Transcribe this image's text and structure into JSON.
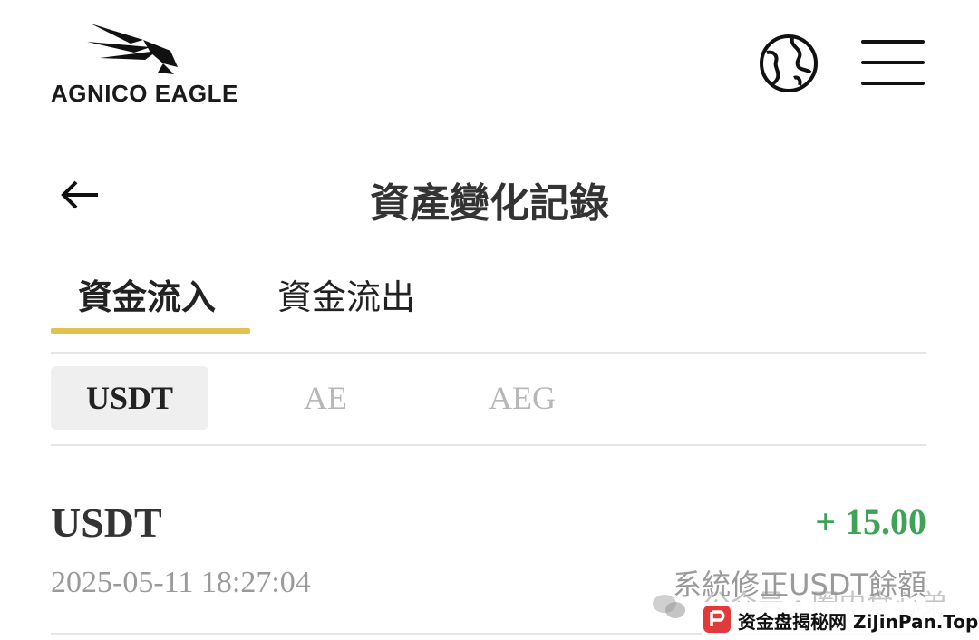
{
  "header": {
    "logo_text": "AGNICO EAGLE",
    "globe_icon": "globe-icon",
    "menu_icon": "hamburger-menu-icon"
  },
  "title_bar": {
    "back_icon": "arrow-left-icon",
    "title": "資產變化記錄"
  },
  "tabs": [
    {
      "label": "資金流入",
      "active": true
    },
    {
      "label": "資金流出",
      "active": false
    }
  ],
  "currency_filter": [
    {
      "label": "USDT",
      "active": true
    },
    {
      "label": "AE",
      "active": false
    },
    {
      "label": "AEG",
      "active": false
    }
  ],
  "records": [
    {
      "currency": "USDT",
      "amount": "+ 15.00",
      "timestamp": "2025-05-11 18:27:04",
      "description": "系統修正USDT餘額"
    }
  ],
  "watermarks": {
    "wechat": "公众号・圈内食心弟",
    "site": "资金盘揭秘网 ZiJinPan.Top"
  },
  "colors": {
    "accent_underline": "#e2c14e",
    "positive_amount": "#3fa357",
    "muted_text": "#9a9a9a",
    "active_chip_bg": "#efefef"
  }
}
